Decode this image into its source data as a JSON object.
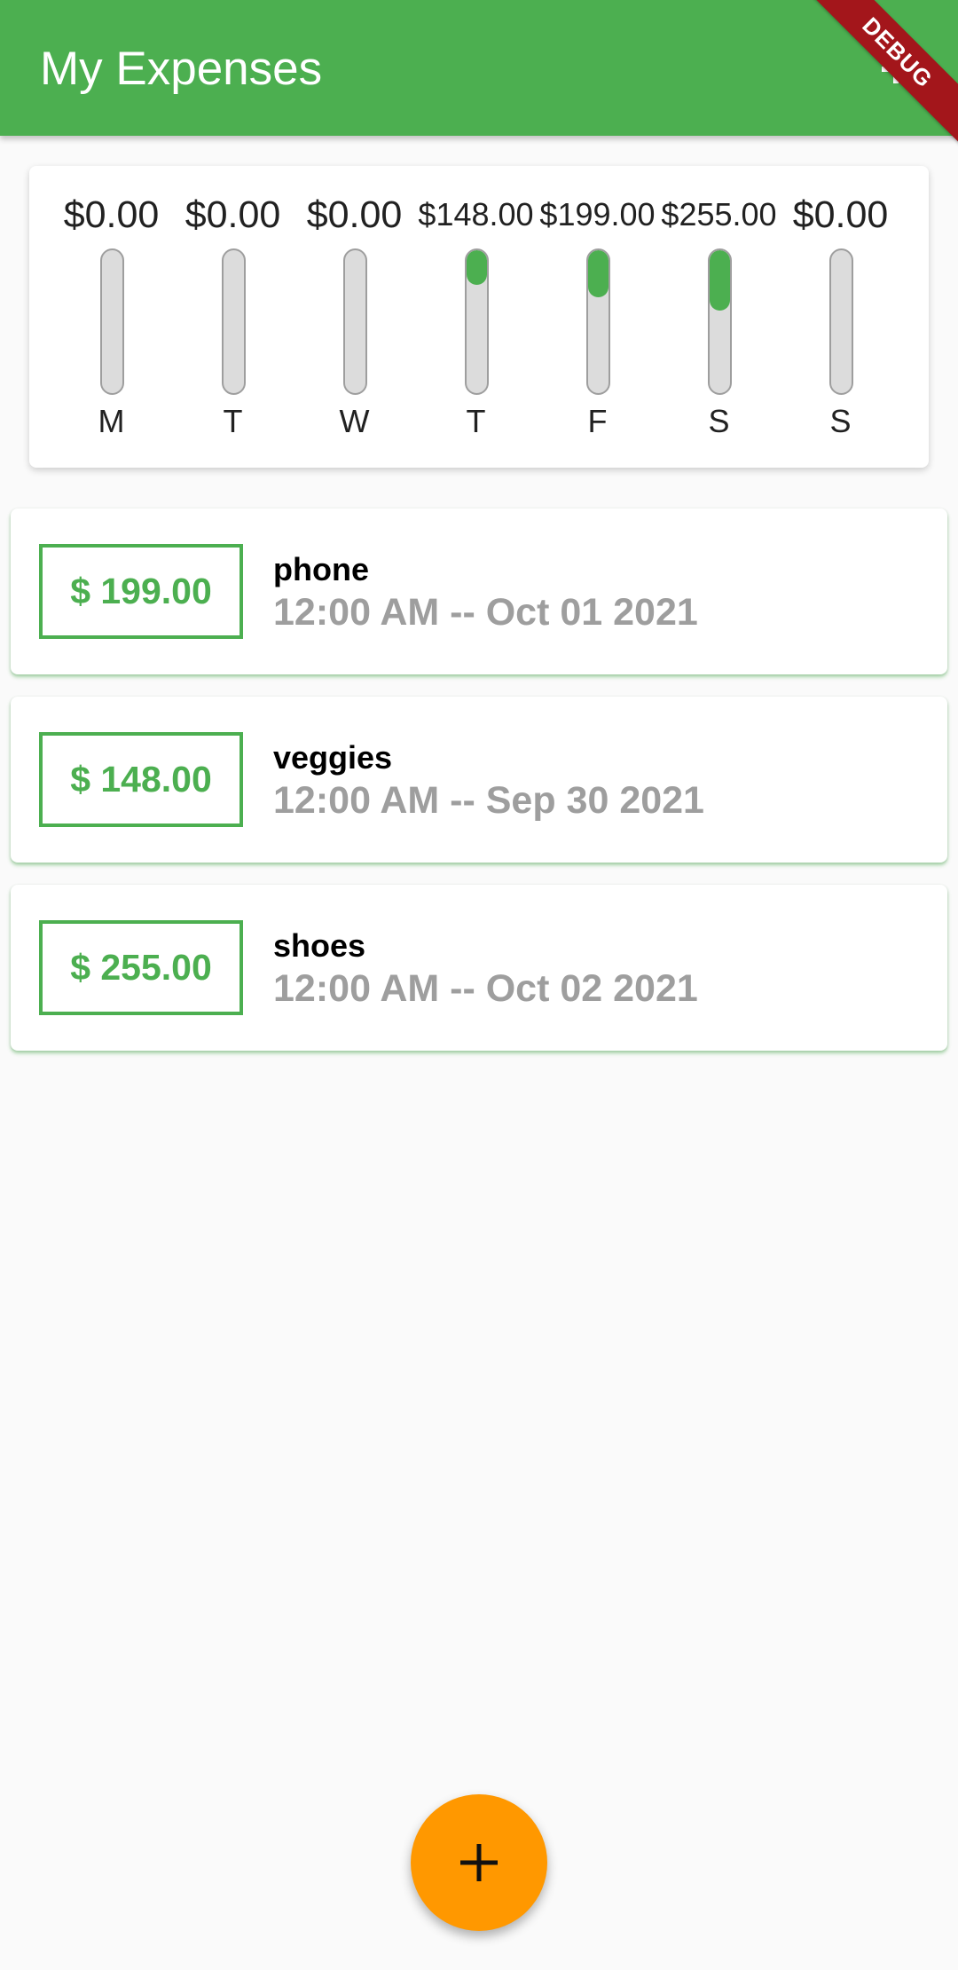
{
  "appbar": {
    "title": "My Expenses",
    "debug_label": "DEBUG",
    "color": "#4caf50"
  },
  "chart": {
    "days": [
      {
        "day": "M",
        "amount": "$0.00",
        "fill_fraction": 0
      },
      {
        "day": "T",
        "amount": "$0.00",
        "fill_fraction": 0
      },
      {
        "day": "W",
        "amount": "$0.00",
        "fill_fraction": 0
      },
      {
        "day": "T",
        "amount": "$148.00",
        "fill_fraction": 0.245
      },
      {
        "day": "F",
        "amount": "$199.00",
        "fill_fraction": 0.33
      },
      {
        "day": "S",
        "amount": "$255.00",
        "fill_fraction": 0.423
      },
      {
        "day": "S",
        "amount": "$0.00",
        "fill_fraction": 0
      }
    ]
  },
  "transactions": [
    {
      "amount": "$ 199.00",
      "title": "phone",
      "date": "12:00 AM -- Oct 01 2021"
    },
    {
      "amount": "$ 148.00",
      "title": "veggies",
      "date": "12:00 AM -- Sep 30 2021"
    },
    {
      "amount": "$ 255.00",
      "title": "shoes",
      "date": "12:00 AM -- Oct 02 2021"
    }
  ],
  "fab": {
    "icon": "add-icon",
    "color": "#ff9800"
  }
}
